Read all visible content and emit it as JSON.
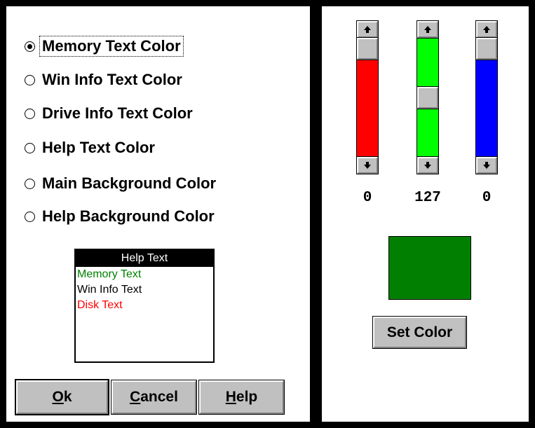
{
  "options": [
    {
      "label": "Memory Text Color",
      "selected": true
    },
    {
      "label": "Win Info Text Color",
      "selected": false
    },
    {
      "label": "Drive Info Text Color",
      "selected": false
    },
    {
      "label": "Help Text Color",
      "selected": false
    },
    {
      "label": "Main Background Color",
      "selected": false
    },
    {
      "label": "Help Background Color",
      "selected": false
    }
  ],
  "preview": {
    "title": "Help Text",
    "lines": [
      {
        "text": "Memory Text",
        "color": "#008000"
      },
      {
        "text": "Win Info Text",
        "color": "#000000"
      },
      {
        "text": "Disk Text",
        "color": "#ff0000"
      }
    ],
    "title_bg": "#000000",
    "title_color": "#ffffff"
  },
  "buttons": {
    "ok": {
      "mnemonic": "O",
      "rest": "k"
    },
    "cancel": {
      "mnemonic": "C",
      "rest": "ancel"
    },
    "help": {
      "mnemonic": "H",
      "rest": "elp"
    }
  },
  "sliders": [
    {
      "channel": "red",
      "value": "0",
      "color": "#ff0000",
      "fraction": 0.0
    },
    {
      "channel": "green",
      "value": "127",
      "color": "#00ff00",
      "fraction": 0.5
    },
    {
      "channel": "blue",
      "value": "0",
      "color": "#0000ff",
      "fraction": 0.0
    }
  ],
  "swatch_color": "#007f00",
  "set_color_label": "Set Color",
  "icons": {
    "up": "up-arrow-icon",
    "down": "down-arrow-icon"
  }
}
